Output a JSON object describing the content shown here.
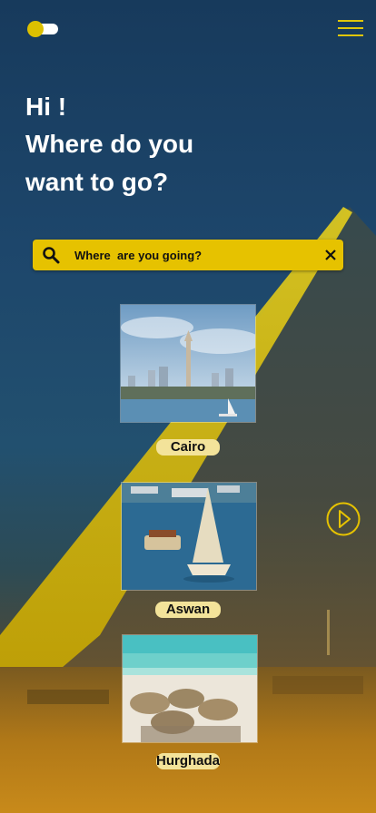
{
  "header": {
    "theme_toggle": {
      "icon": "toggle-switch-icon",
      "knob_color": "#dcc000",
      "state": "off"
    },
    "menu": {
      "icon": "hamburger-menu-icon",
      "color": "#e1c60a"
    }
  },
  "greeting": {
    "line1": "Hi !",
    "line2": "Where do you",
    "line3": "want to go?"
  },
  "search": {
    "placeholder": "Where  are you going?",
    "value": "",
    "icons": {
      "search": "search-icon",
      "clear": "close-icon"
    }
  },
  "destinations": [
    {
      "name": "Cairo",
      "image": "city-skyline-image"
    },
    {
      "name": "Aswan",
      "image": "sailboat-river-image"
    },
    {
      "name": "Hurghada",
      "image": "beach-umbrellas-image"
    }
  ],
  "carousel": {
    "next_icon": "play-circle-icon"
  },
  "colors": {
    "accent": "#e6c200",
    "label_bg": "#f3e39a",
    "text": "#ffffff",
    "bg_dark": "#173a5c"
  }
}
